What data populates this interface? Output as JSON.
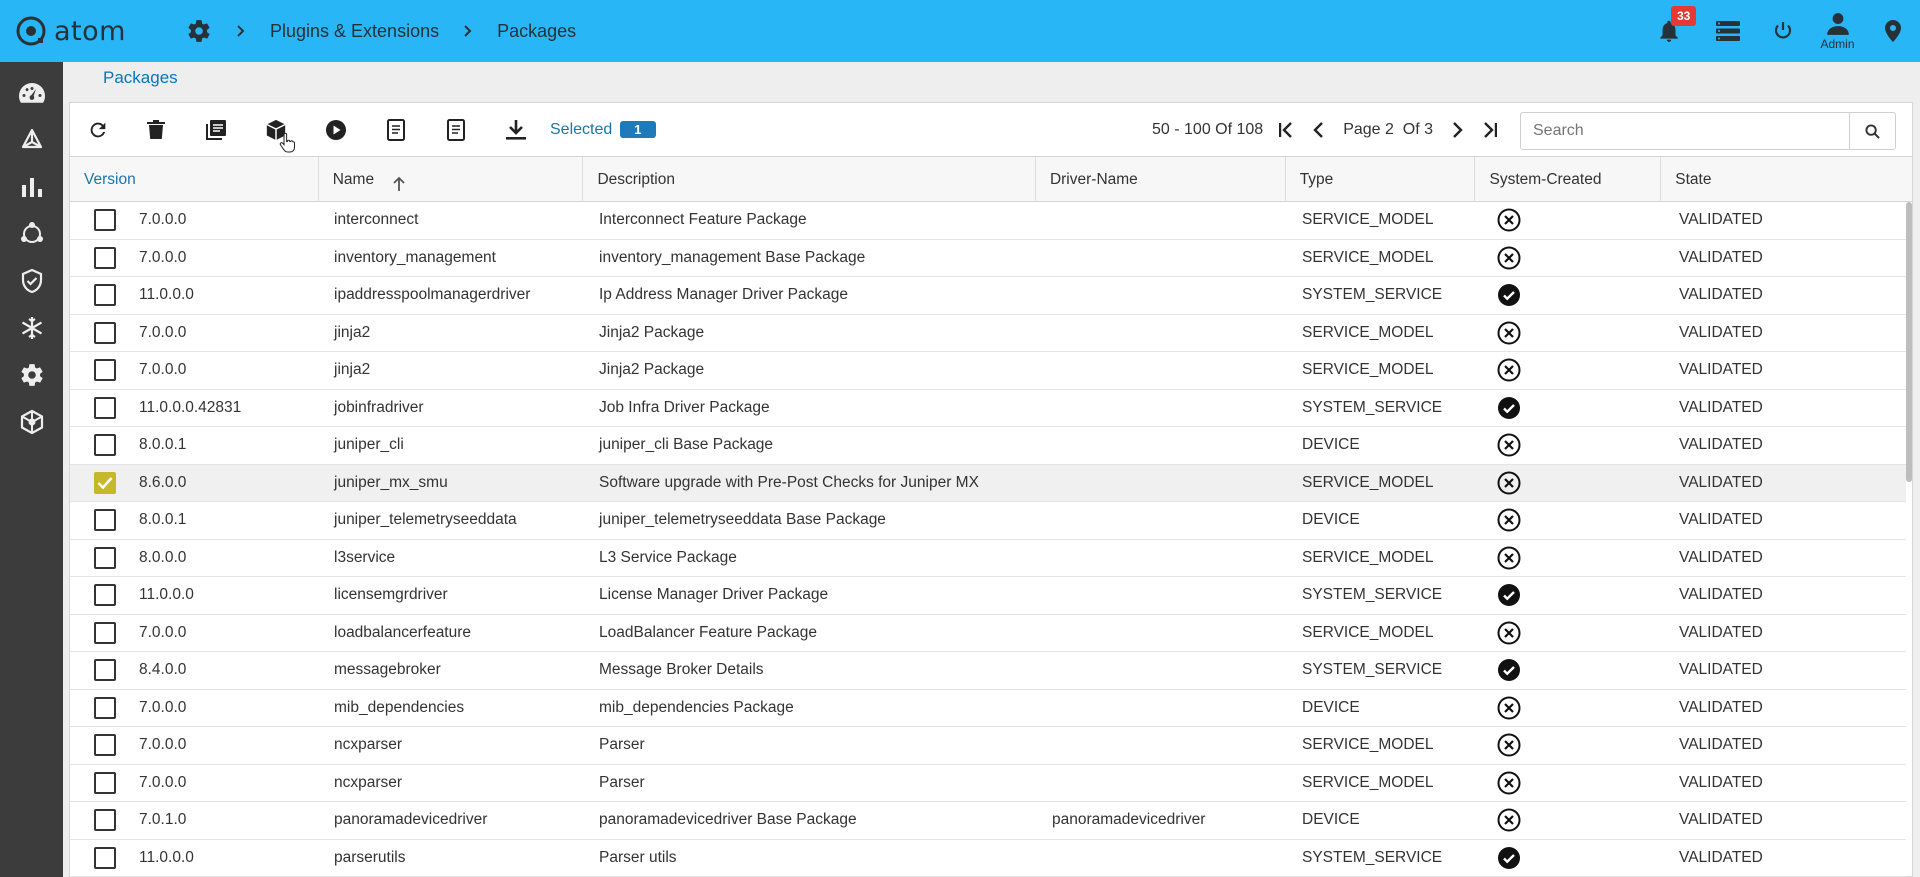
{
  "app": {
    "logo_text": "atom"
  },
  "breadcrumb": [
    "Plugins & Extensions",
    "Packages"
  ],
  "notifications": {
    "count": "33"
  },
  "user": {
    "label": "Admin"
  },
  "page": {
    "title": "Packages"
  },
  "toolbar": {
    "selected_label": "Selected",
    "selected_count": "1"
  },
  "pager": {
    "range": "50 - 100 Of 108",
    "page_text": "Page 2  Of 3"
  },
  "search": {
    "placeholder": "Search",
    "value": ""
  },
  "columns": [
    "Version",
    "Name",
    "Description",
    "Driver-Name",
    "Type",
    "System-Created",
    "State"
  ],
  "rows": [
    {
      "checked": false,
      "version": "7.0.0.0",
      "name": "interconnect",
      "description": "Interconnect Feature Package",
      "driver": "",
      "type": "SERVICE_MODEL",
      "system": false,
      "state": "VALIDATED"
    },
    {
      "checked": false,
      "version": "7.0.0.0",
      "name": "inventory_management",
      "description": "inventory_management Base Package",
      "driver": "",
      "type": "SERVICE_MODEL",
      "system": false,
      "state": "VALIDATED"
    },
    {
      "checked": false,
      "version": "11.0.0.0",
      "name": "ipaddresspoolmanagerdriver",
      "description": "Ip Address Manager Driver Package",
      "driver": "",
      "type": "SYSTEM_SERVICE",
      "system": true,
      "state": "VALIDATED"
    },
    {
      "checked": false,
      "version": "7.0.0.0",
      "name": "jinja2",
      "description": "Jinja2 Package",
      "driver": "",
      "type": "SERVICE_MODEL",
      "system": false,
      "state": "VALIDATED"
    },
    {
      "checked": false,
      "version": "7.0.0.0",
      "name": "jinja2",
      "description": "Jinja2 Package",
      "driver": "",
      "type": "SERVICE_MODEL",
      "system": false,
      "state": "VALIDATED"
    },
    {
      "checked": false,
      "version": "11.0.0.0.42831",
      "name": "jobinfradriver",
      "description": "Job Infra Driver Package",
      "driver": "",
      "type": "SYSTEM_SERVICE",
      "system": true,
      "state": "VALIDATED"
    },
    {
      "checked": false,
      "version": "8.0.0.1",
      "name": "juniper_cli",
      "description": "juniper_cli Base Package",
      "driver": "",
      "type": "DEVICE",
      "system": false,
      "state": "VALIDATED"
    },
    {
      "checked": true,
      "version": "8.6.0.0",
      "name": "juniper_mx_smu",
      "description": "Software upgrade with Pre-Post Checks for Juniper MX",
      "driver": "",
      "type": "SERVICE_MODEL",
      "system": false,
      "state": "VALIDATED"
    },
    {
      "checked": false,
      "version": "8.0.0.1",
      "name": "juniper_telemetryseeddata",
      "description": "juniper_telemetryseeddata Base Package",
      "driver": "",
      "type": "DEVICE",
      "system": false,
      "state": "VALIDATED"
    },
    {
      "checked": false,
      "version": "8.0.0.0",
      "name": "l3service",
      "description": "L3 Service Package",
      "driver": "",
      "type": "SERVICE_MODEL",
      "system": false,
      "state": "VALIDATED"
    },
    {
      "checked": false,
      "version": "11.0.0.0",
      "name": "licensemgrdriver",
      "description": "License Manager Driver Package",
      "driver": "",
      "type": "SYSTEM_SERVICE",
      "system": true,
      "state": "VALIDATED"
    },
    {
      "checked": false,
      "version": "7.0.0.0",
      "name": "loadbalancerfeature",
      "description": "LoadBalancer Feature Package",
      "driver": "",
      "type": "SERVICE_MODEL",
      "system": false,
      "state": "VALIDATED"
    },
    {
      "checked": false,
      "version": "8.4.0.0",
      "name": "messagebroker",
      "description": "Message Broker Details",
      "driver": "",
      "type": "SYSTEM_SERVICE",
      "system": true,
      "state": "VALIDATED"
    },
    {
      "checked": false,
      "version": "7.0.0.0",
      "name": "mib_dependencies",
      "description": "mib_dependencies Package",
      "driver": "",
      "type": "DEVICE",
      "system": false,
      "state": "VALIDATED"
    },
    {
      "checked": false,
      "version": "7.0.0.0",
      "name": "ncxparser",
      "description": "Parser",
      "driver": "",
      "type": "SERVICE_MODEL",
      "system": false,
      "state": "VALIDATED"
    },
    {
      "checked": false,
      "version": "7.0.0.0",
      "name": "ncxparser",
      "description": "Parser",
      "driver": "",
      "type": "SERVICE_MODEL",
      "system": false,
      "state": "VALIDATED"
    },
    {
      "checked": false,
      "version": "7.0.1.0",
      "name": "panoramadevicedriver",
      "description": "panoramadevicedriver Base Package",
      "driver": "panoramadevicedriver",
      "type": "DEVICE",
      "system": false,
      "state": "VALIDATED"
    },
    {
      "checked": false,
      "version": "11.0.0.0",
      "name": "parserutils",
      "description": "Parser utils",
      "driver": "",
      "type": "SYSTEM_SERVICE",
      "system": true,
      "state": "VALIDATED"
    }
  ]
}
